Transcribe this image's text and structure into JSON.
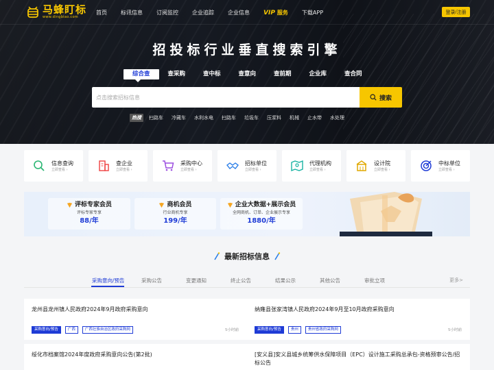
{
  "header": {
    "logo_title": "马蜂盯标",
    "logo_sub": "www.dingbiao.com",
    "nav": [
      "首页",
      "标讯信息",
      "订阅监控",
      "企业追踪",
      "企业信息"
    ],
    "vip_badge": "VIP",
    "vip_label": "服务",
    "app_label": "下载APP",
    "login_label": "登录/注册"
  },
  "hero": {
    "slogan": "招投标行业垂直搜索引擎",
    "tabs": [
      "综合查",
      "查采购",
      "查中标",
      "查意向",
      "查前期",
      "企业库",
      "查合同"
    ],
    "active_tab": 0,
    "search_placeholder": "点击搜索招标信息",
    "search_button": "搜索",
    "hot_tag": "热搜",
    "hot_keywords": [
      "扫路车",
      "冷藏车",
      "水利水电",
      "扫路车",
      "垃圾车",
      "压浆料",
      "机械",
      "止水带",
      "水处理"
    ]
  },
  "categories": [
    {
      "title": "信息查询",
      "sub": "立即查看 ›",
      "icon": "search-icon",
      "color": "#2bb673"
    },
    {
      "title": "查企业",
      "sub": "立即查看 ›",
      "icon": "building-icon",
      "color": "#f04b4b"
    },
    {
      "title": "采购中心",
      "sub": "立即查看 ›",
      "icon": "cart-icon",
      "color": "#9b4de0"
    },
    {
      "title": "招标单位",
      "sub": "立即查看 ›",
      "icon": "handshake-icon",
      "color": "#2a7ee8"
    },
    {
      "title": "代理机构",
      "sub": "立即查看 ›",
      "icon": "map-icon",
      "color": "#18b3a3"
    },
    {
      "title": "设计院",
      "sub": "立即查看 ›",
      "icon": "institute-icon",
      "color": "#e0a800"
    },
    {
      "title": "中标单位",
      "sub": "立即查看 ›",
      "icon": "target-icon",
      "color": "#1e3bd6"
    }
  ],
  "vip": [
    {
      "title": "评标专家会员",
      "desc": "评标专家专享",
      "price": "88/年"
    },
    {
      "title": "商机会员",
      "desc": "行业商机专享",
      "price": "199/年"
    },
    {
      "title": "企业大数据+展示会员",
      "desc": "全网商机、订单、企业展示专享",
      "price": "1880/年"
    }
  ],
  "news": {
    "title": "最新招标信息",
    "tabs": [
      "采购意向/预告",
      "采购公告",
      "变更通知",
      "终止公告",
      "结果公示",
      "其他公告",
      "审批立项"
    ],
    "more": "更多>",
    "rows": [
      [
        {
          "title": "龙州县龙州镇人民政府2024年9月政府采购意向",
          "type": "采购意向/预告",
          "region": "广西",
          "source": "广西壮族自治区政府采购网",
          "time": "5小时前"
        },
        {
          "title": "纳雍县张家湾镇人民政府2024年9月至10月政府采购意向",
          "type": "采购意向/预告",
          "region": "贵州",
          "source": "贵州省政府采购网",
          "time": "5小时前"
        }
      ],
      [
        {
          "title": "绥化市档案馆2024年度政府采购意向公告(第2批)"
        },
        {
          "title": "[安义县]安义县城乡统筹供水保障项目（EPC）设计施工采购总承包-资格预审公告/招标公告"
        }
      ]
    ]
  },
  "colors": {
    "accent": "#f7c600",
    "primary": "#1e3bd6",
    "hero_bg": "#12151c"
  }
}
